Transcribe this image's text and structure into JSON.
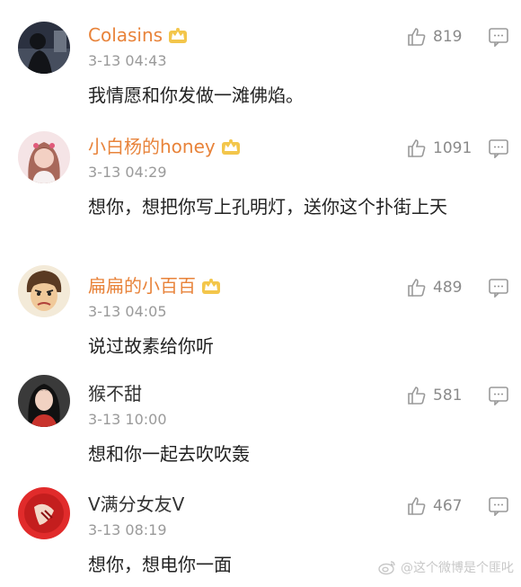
{
  "comments": [
    {
      "username": "Colasins",
      "vip": true,
      "timestamp": "3-13 04:43",
      "likes": "819",
      "text": "我情愿和你发做一滩佛焰。"
    },
    {
      "username": "小白杨的honey",
      "vip": true,
      "timestamp": "3-13 04:29",
      "likes": "1091",
      "text": "想你，想把你写上孔明灯，送你这个扑街上天"
    },
    {
      "username": "扁扁的小百百",
      "vip": true,
      "timestamp": "3-13 04:05",
      "likes": "489",
      "text": "说过故素给你听"
    },
    {
      "username": "猴不甜",
      "vip": false,
      "timestamp": "3-13 10:00",
      "likes": "581",
      "text": "想和你一起去吹吹轰"
    },
    {
      "username": "V满分女友V",
      "vip": false,
      "timestamp": "3-13 08:19",
      "likes": "467",
      "text": "想你，想电你一面"
    }
  ],
  "watermark": {
    "text": "@这个微博是个匪叱"
  },
  "colors": {
    "username_vip": "#e8833a",
    "icon_gray": "#9a9a9a"
  }
}
